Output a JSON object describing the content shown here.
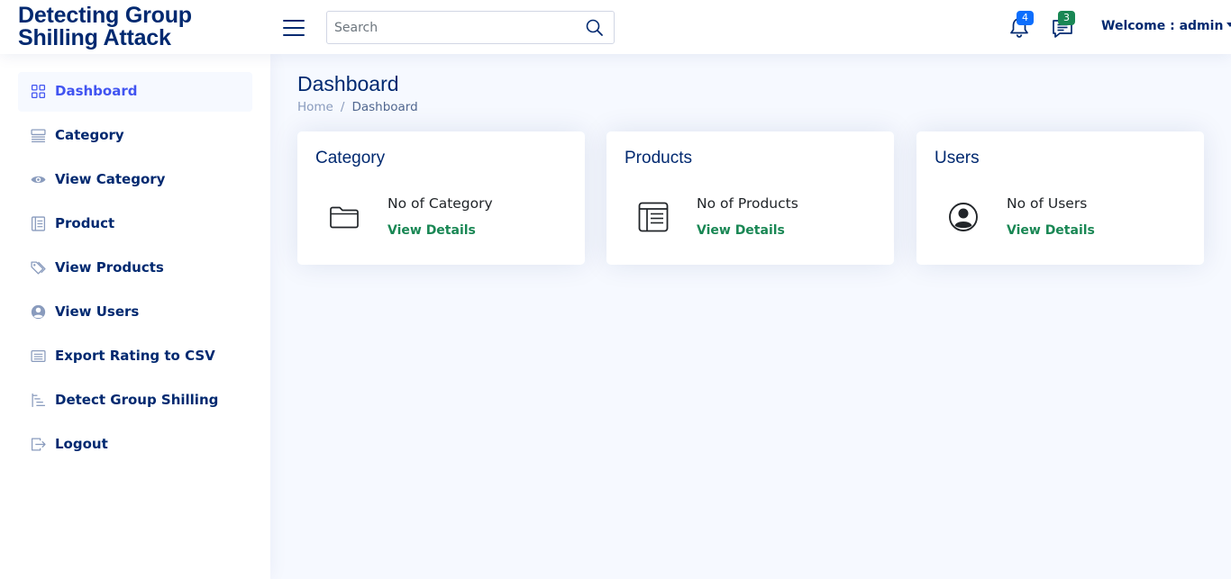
{
  "brand": {
    "line1": "Detecting Group",
    "line2": "Shilling Attack"
  },
  "search": {
    "placeholder": "Search"
  },
  "notifications": {
    "count": "4",
    "color": "#0d6efd"
  },
  "messages": {
    "count": "3",
    "color": "#198754"
  },
  "user": {
    "welcome": "Welcome : admin"
  },
  "sidebar": {
    "items": [
      {
        "label": "Dashboard",
        "icon": "grid-icon",
        "active": true
      },
      {
        "label": "Category",
        "icon": "menu-button-icon"
      },
      {
        "label": "View Category",
        "icon": "eye-icon"
      },
      {
        "label": "Product",
        "icon": "layout-text-icon"
      },
      {
        "label": "View Products",
        "icon": "tags-icon"
      },
      {
        "label": "View Users",
        "icon": "person-circle-icon"
      },
      {
        "label": "Export Rating to CSV",
        "icon": "card-list-icon"
      },
      {
        "label": "Detect Group Shilling",
        "icon": "list-nested-icon"
      },
      {
        "label": "Logout",
        "icon": "box-arrow-right-icon"
      }
    ]
  },
  "page": {
    "title": "Dashboard",
    "breadcrumb": {
      "home": "Home",
      "current": "Dashboard"
    }
  },
  "cards": [
    {
      "title": "Category",
      "label": "No of Category",
      "link": "View Details",
      "icon": "folder-icon"
    },
    {
      "title": "Products",
      "label": "No of Products",
      "link": "View Details",
      "icon": "layout-text-window-icon"
    },
    {
      "title": "Users",
      "label": "No of Users",
      "link": "View Details",
      "icon": "person-circle-icon"
    }
  ],
  "colors": {
    "primary": "#012970",
    "accent": "#4154f1",
    "link": "#198754",
    "background": "#f6f9ff"
  }
}
